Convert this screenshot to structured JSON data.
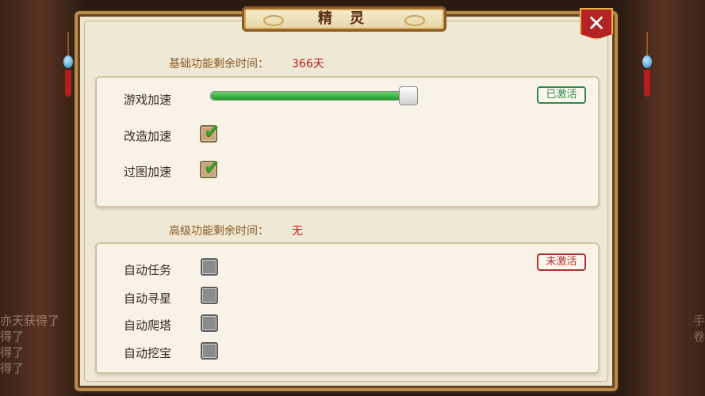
{
  "dialog": {
    "title": "精 灵",
    "close_icon": "close-icon"
  },
  "background": {
    "left_lines": [
      "亦天获得了",
      "得了",
      "得了",
      "得了"
    ],
    "right_lines": [
      "手",
      "卷"
    ]
  },
  "basic": {
    "label": "基础功能剩余时间：",
    "value": "366天",
    "status": "已激活",
    "game_speed": {
      "label": "游戏加速",
      "level": 0.97
    },
    "items": [
      {
        "label": "改造加速",
        "checked": true
      },
      {
        "label": "过图加速",
        "checked": true
      }
    ]
  },
  "advanced": {
    "label": "高级功能剩余时间：",
    "value": "无",
    "status": "未激活",
    "items": [
      {
        "label": "自动任务",
        "checked": false
      },
      {
        "label": "自动寻星",
        "checked": false
      },
      {
        "label": "自动爬塔",
        "checked": false
      },
      {
        "label": "自动挖宝",
        "checked": false
      }
    ]
  },
  "colors": {
    "accent_red": "#c21a1a",
    "active_green": "#2f8a4f",
    "inactive_red": "#b23030",
    "slider_green": "#1f9b2c"
  }
}
